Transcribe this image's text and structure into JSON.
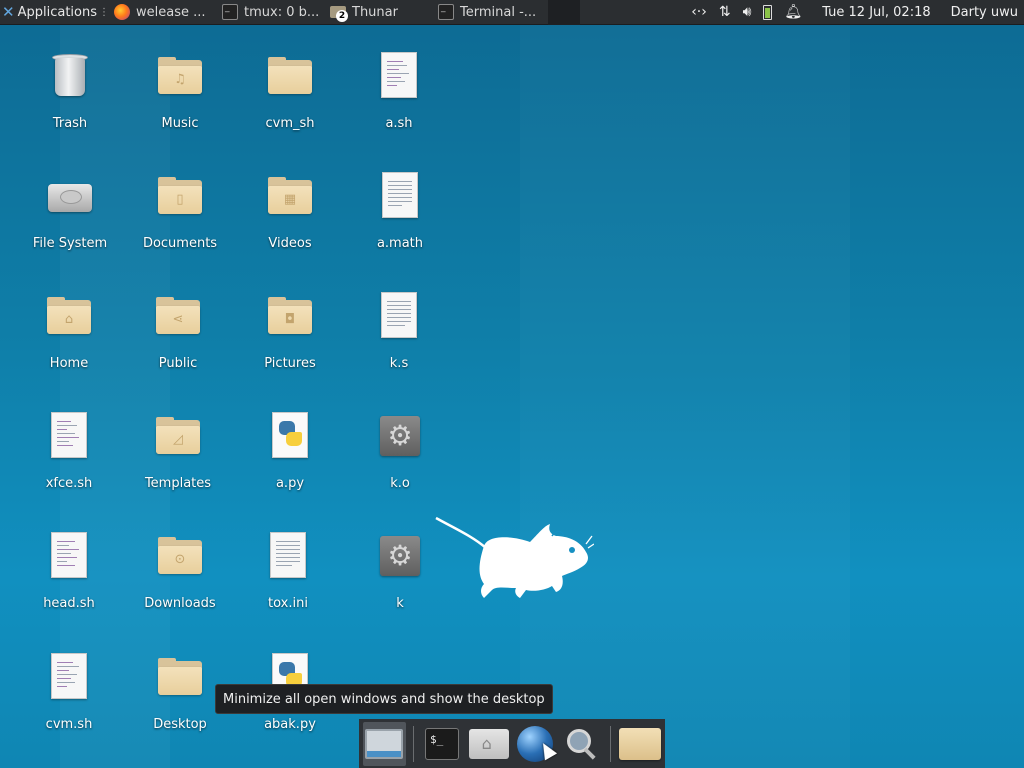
{
  "top_panel": {
    "applications_label": "Applications",
    "tasks": [
      {
        "label": "welease ...",
        "icon": "firefox-icon"
      },
      {
        "label": "tmux: 0 b...",
        "icon": "terminal-icon"
      },
      {
        "label": "Thunar",
        "icon": "folder-icon",
        "badge": "2"
      },
      {
        "label": "Terminal -...",
        "icon": "terminal-icon"
      }
    ],
    "tray": {
      "network_icon": "network-arrows-icon",
      "transfer_icon": "up-down-arrows-icon",
      "volume_icon": "speaker-icon",
      "battery_icon": "battery-icon",
      "notification_icon": "bell-icon"
    },
    "clock": "Tue 12 Jul, 02:18",
    "user": "Darty uwu"
  },
  "desktop": {
    "icons": [
      {
        "label": "Trash",
        "type": "trash"
      },
      {
        "label": "File System",
        "type": "drive"
      },
      {
        "label": "Home",
        "type": "folder-home"
      },
      {
        "label": "xfce.sh",
        "type": "script"
      },
      {
        "label": "head.sh",
        "type": "script"
      },
      {
        "label": "cvm.sh",
        "type": "script"
      },
      {
        "label": "Music",
        "type": "folder-music"
      },
      {
        "label": "Documents",
        "type": "folder-documents"
      },
      {
        "label": "Public",
        "type": "folder-public"
      },
      {
        "label": "Templates",
        "type": "folder-templates"
      },
      {
        "label": "Downloads",
        "type": "folder-downloads"
      },
      {
        "label": "Desktop",
        "type": "folder"
      },
      {
        "label": "cvm_sh",
        "type": "folder"
      },
      {
        "label": "Videos",
        "type": "folder-videos"
      },
      {
        "label": "Pictures",
        "type": "folder-pictures"
      },
      {
        "label": "a.py",
        "type": "python"
      },
      {
        "label": "tox.ini",
        "type": "text"
      },
      {
        "label": "abak.py",
        "type": "python"
      },
      {
        "label": "a.sh",
        "type": "script"
      },
      {
        "label": "a.math",
        "type": "text"
      },
      {
        "label": "k.s",
        "type": "text"
      },
      {
        "label": "k.o",
        "type": "binary"
      },
      {
        "label": "k",
        "type": "binary"
      }
    ]
  },
  "tooltip": {
    "text": "Minimize all open windows and show the desktop"
  },
  "dock": {
    "items": [
      {
        "name": "show-desktop",
        "icon": "show-desktop-icon"
      },
      {
        "name": "terminal",
        "icon": "terminal-icon",
        "text": "$_"
      },
      {
        "name": "home-folder",
        "icon": "home-folder-icon"
      },
      {
        "name": "web-browser",
        "icon": "globe-icon"
      },
      {
        "name": "app-finder",
        "icon": "magnifier-icon"
      },
      {
        "name": "file-manager",
        "icon": "folder-icon"
      }
    ]
  }
}
